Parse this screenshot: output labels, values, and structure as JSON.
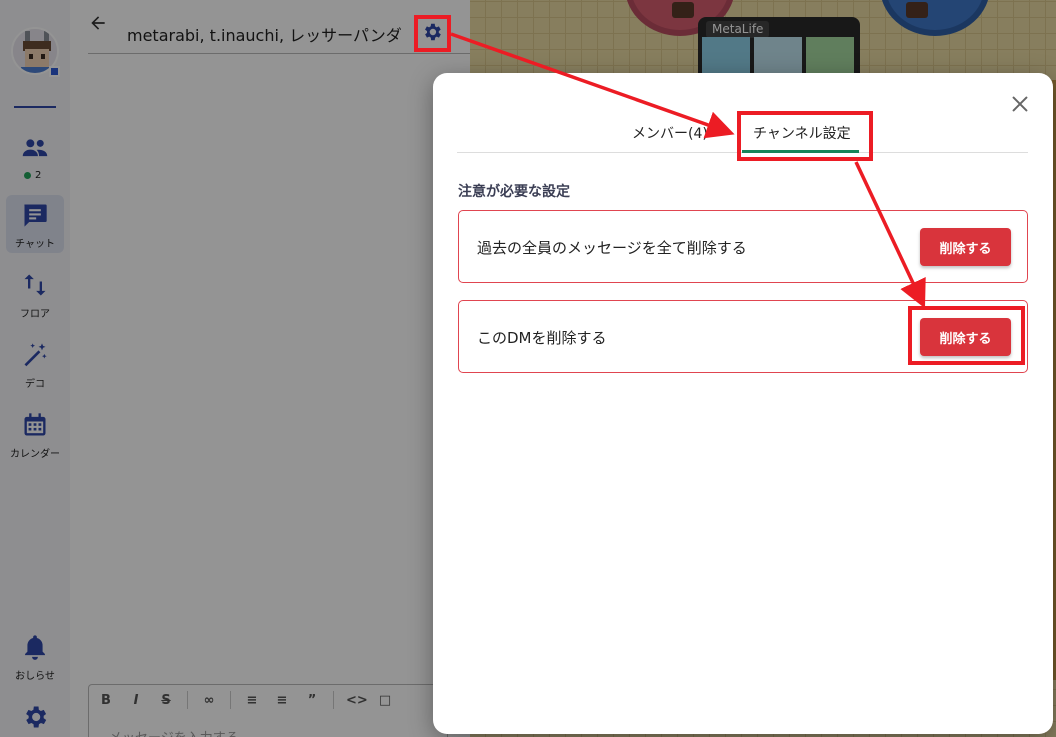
{
  "sidebar": {
    "online_count": "2",
    "items": [
      {
        "label": ""
      },
      {
        "label": "チャット"
      },
      {
        "label": "フロア"
      },
      {
        "label": "デコ"
      },
      {
        "label": "カレンダー"
      }
    ],
    "notifications_label": "おしらせ"
  },
  "chat": {
    "title": "metarabi, t.inauchi, レッサーパンダ",
    "composer_placeholder": "メッセージを入力する"
  },
  "map": {
    "kiosk_label": "MetaLife"
  },
  "dialog": {
    "tabs": [
      {
        "label": "メンバー(4)"
      },
      {
        "label": "チャンネル設定"
      }
    ],
    "active_tab": 1,
    "section_title": "注意が必要な設定",
    "actions": [
      {
        "text": "過去の全員のメッセージを全て削除する",
        "button": "削除する"
      },
      {
        "text": "このDMを削除する",
        "button": "削除する"
      }
    ]
  },
  "colors": {
    "danger": "#d9343c",
    "tab_active": "#17855a",
    "annotation": "#ec1c24"
  }
}
